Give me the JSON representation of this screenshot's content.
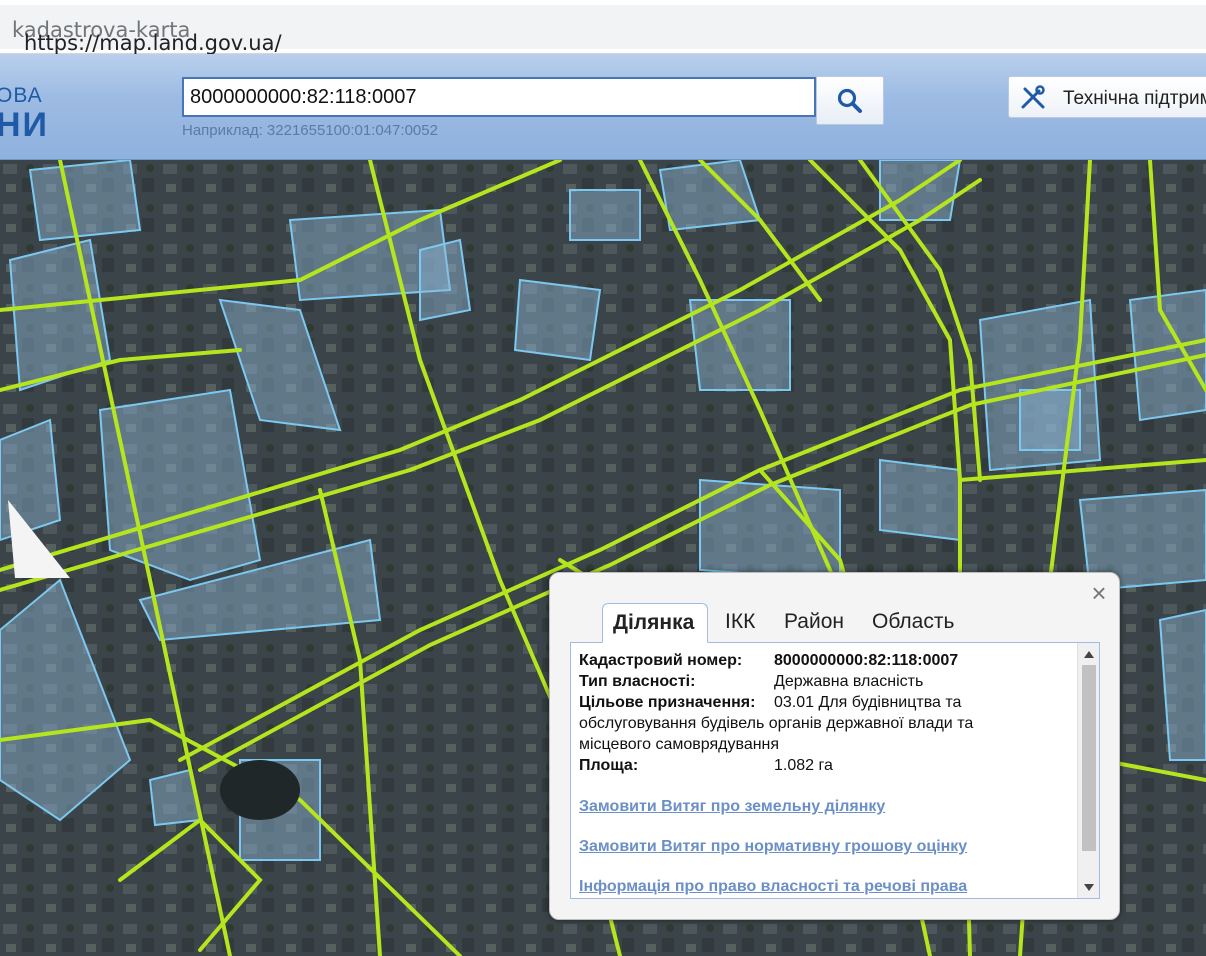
{
  "browser": {
    "url_host": "https://map.land.gov.ua/",
    "url_path": "kadastrova-karta"
  },
  "header": {
    "logo_line1": "ОВА",
    "logo_line2": "НИ",
    "search_value": "8000000000:82:118:0007",
    "search_hint": "Наприклад: 3221655100:01:047:0052",
    "support_label": "Технічна підтрим"
  },
  "popup": {
    "close_symbol": "×",
    "tabs": [
      "Ділянка",
      "ІКК",
      "Район",
      "Область"
    ],
    "active_tab": "Ділянка",
    "fields": {
      "cadastral_label": "Кадастровий номер:",
      "cadastral_value": "8000000000:82:118:0007",
      "ownership_label": "Тип власності:",
      "ownership_value": "Державна власність",
      "purpose_label": "Цільове призначення:",
      "purpose_value_line1": "03.01 Для будівництва та",
      "purpose_value_line2": "обслуговування будівель органів державної влади та",
      "purpose_value_line3": "місцевого самоврядування",
      "area_label": "Площа:",
      "area_value": "1.082 га"
    },
    "links": [
      "Замовити Витяг про земельну ділянку",
      "Замовити Витяг про нормативну грошову оцінку",
      "Інформація про право власності та речові права"
    ]
  },
  "colors": {
    "road_line": "#b5e61d",
    "parcel_outline": "#7cc8f0",
    "header_bg": "#9dbbe3"
  }
}
